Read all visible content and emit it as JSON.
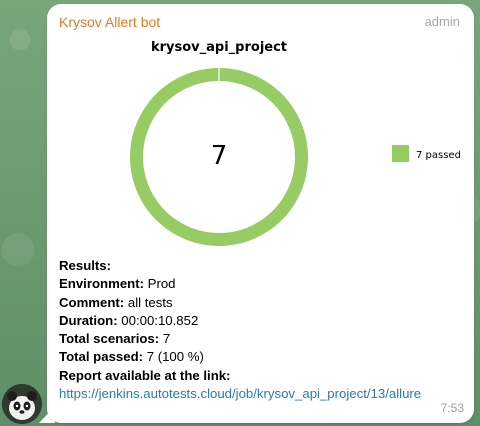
{
  "message": {
    "sender": "Krysov Allert bot",
    "role": "admin",
    "time": "7:53"
  },
  "chart_data": {
    "type": "pie",
    "title": "krysov_api_project",
    "center_label": "7",
    "categories": [
      "passed"
    ],
    "values": [
      7
    ],
    "legend": [
      {
        "label": "7 passed",
        "color": "#97cc64"
      }
    ],
    "legend_position": "right",
    "colors": {
      "passed": "#97cc64"
    }
  },
  "results": {
    "header": "Results:",
    "environment_label": "Environment:",
    "environment_value": " Prod",
    "comment_label": "Comment:",
    "comment_value": " all tests",
    "duration_label": "Duration:",
    "duration_value": " 00:00:10.852",
    "total_scenarios_label": "Total scenarios:",
    "total_scenarios_value": " 7",
    "total_passed_label": "Total passed:",
    "total_passed_value": " 7 (100 %)",
    "report_label": "Report available at the link:",
    "report_link": "https://jenkins.autotests.cloud/job/krysov_api_project/13/allure"
  }
}
